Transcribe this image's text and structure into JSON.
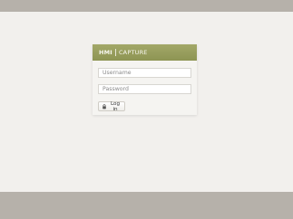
{
  "app": {
    "brand_primary": "HMI",
    "brand_secondary": "CAPTURE"
  },
  "login_form": {
    "username_placeholder": "Username",
    "password_placeholder": "Password",
    "login_button_label": "Log in",
    "login_icon": "lock-icon"
  },
  "colors": {
    "page_background": "#f2f0ed",
    "bars": "#b6b1aa",
    "header_accent": "#8d9453"
  }
}
